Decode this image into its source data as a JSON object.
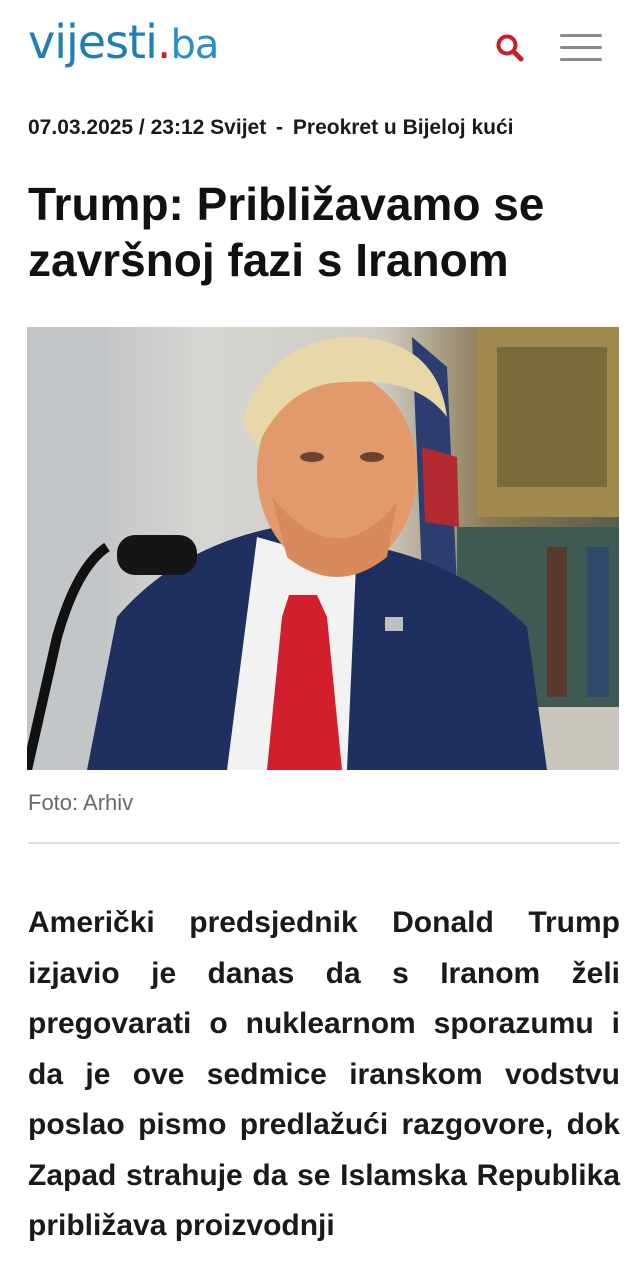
{
  "header": {
    "logo_main": "vijesti",
    "logo_dot": ".",
    "logo_tld": "ba",
    "search_icon": "search-icon",
    "menu_icon": "hamburger-menu-icon"
  },
  "article": {
    "datetime": "07.03.2025 / 23:12",
    "category": "Svijet",
    "separator": "-",
    "tag": "Preokret u Bijeloj kući",
    "title": "Trump: Približavamo se završnoj fazi s Iranom",
    "photo_caption": "Foto: Arhiv",
    "body": "Američki predsjednik Donald Trump izjavio je danas da s Iranom želi pregovarati o nuklearnom sporazumu i da je ove sedmice iranskom vodstvu poslao pismo predlažući razgovore, dok Zapad strahuje da se Islamska Republika približava proizvodnji"
  },
  "colors": {
    "brand_blue": "#1f7fb0",
    "brand_red": "#d01f2a",
    "search_red": "#c8202a"
  }
}
